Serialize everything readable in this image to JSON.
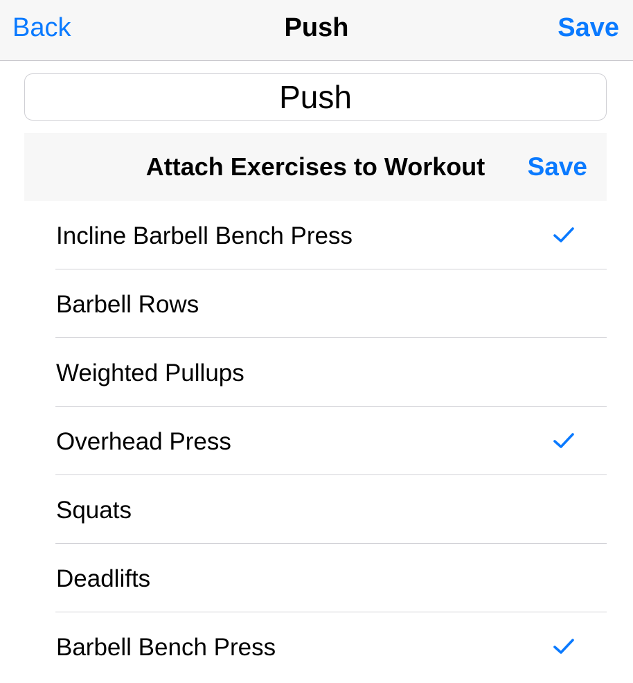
{
  "nav": {
    "back_label": "Back",
    "title": "Push",
    "save_label": "Save"
  },
  "workout_name": {
    "value": "Push"
  },
  "section": {
    "title": "Attach Exercises to Workout",
    "save_label": "Save"
  },
  "colors": {
    "accent": "#0a7aff",
    "bar_background": "#f7f7f7",
    "separator": "#d1d1d6"
  },
  "exercises": [
    {
      "label": "Incline Barbell Bench Press",
      "selected": true
    },
    {
      "label": "Barbell Rows",
      "selected": false
    },
    {
      "label": "Weighted Pullups",
      "selected": false
    },
    {
      "label": "Overhead Press",
      "selected": true
    },
    {
      "label": "Squats",
      "selected": false
    },
    {
      "label": "Deadlifts",
      "selected": false
    },
    {
      "label": "Barbell Bench Press",
      "selected": true
    }
  ]
}
